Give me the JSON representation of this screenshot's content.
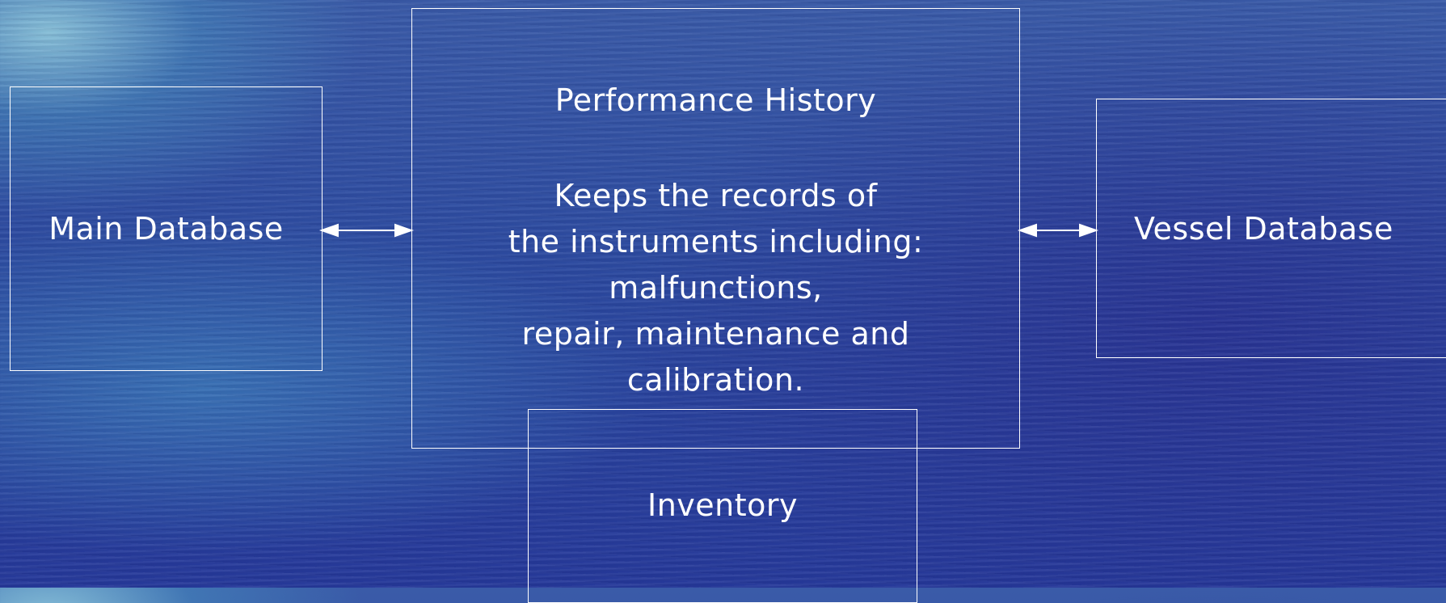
{
  "diagram": {
    "main_database": {
      "label": "Main Database"
    },
    "performance_history": {
      "title": "Performance History",
      "description_lines": [
        "Keeps the records of",
        "the instruments including:",
        "malfunctions,",
        "repair, maintenance and",
        "calibration."
      ]
    },
    "vessel_database": {
      "label": "Vessel Database"
    },
    "inventory": {
      "label": "Inventory"
    },
    "connections": [
      {
        "from": "Main Database",
        "to": "Performance History",
        "type": "bidirectional"
      },
      {
        "from": "Performance History",
        "to": "Vessel Database",
        "type": "bidirectional"
      }
    ]
  },
  "colors": {
    "line": "#ffffff",
    "text": "#ffffff",
    "background": "#2c4aa0"
  }
}
